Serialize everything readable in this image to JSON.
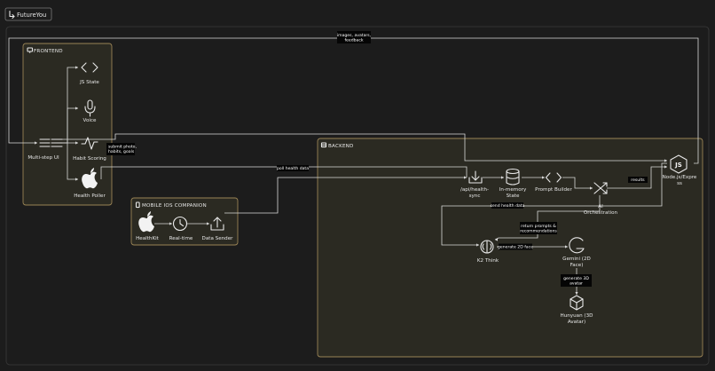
{
  "title": "FutureYou",
  "groups": {
    "frontend": "FRONTEND",
    "mobile": "MOBILE IOS COMPANION",
    "backend": "BACKEND"
  },
  "nodes": {
    "js_state": "JS State",
    "voice": "Voice",
    "multi_step_ui": "Multi-step UI",
    "habit_scoring": "Habit Scoring",
    "health_poller": "Health Poller",
    "healthkit": "HealthKit",
    "realtime": "Real-time",
    "data_sender": "Data Sender",
    "api_health_sync_1": "/api/health-",
    "api_health_sync_2": "sync",
    "in_memory_1": "In-memory",
    "in_memory_2": "State",
    "prompt_builder": "Prompt Builder",
    "ai_orch_1": "AI",
    "ai_orch_2": "Orchestration",
    "node_express_1": "Node.js/Expre",
    "node_express_2": "ss",
    "k2_think": "K2 Think",
    "gemini_1": "Gemini (2D",
    "gemini_2": "Face)",
    "hunyuan_1": "Hunyuan (3D",
    "hunyuan_2": "Avatar)"
  },
  "edge_labels": {
    "images_1": "images, avatars,",
    "images_2": "feedback",
    "submit_1": "submit photo,",
    "submit_2": "habits, goals",
    "poll": "poll health data",
    "send": "send health data",
    "results": "results",
    "return_1": "return prompts &",
    "return_2": "recommendations",
    "gen2d": "generate 2D face",
    "gen3d_1": "generate 3D",
    "gen3d_2": "avatar"
  },
  "colors": {
    "background": "#1c1c1c",
    "group_border": "#9a8455",
    "group_fill": "#2b2a22",
    "line": "#d9d9d9",
    "label_bg": "#050505"
  },
  "icons": {
    "title": "flow-icon",
    "frontend": "monitor-icon",
    "mobile": "phone-icon",
    "backend": "server-icon"
  }
}
